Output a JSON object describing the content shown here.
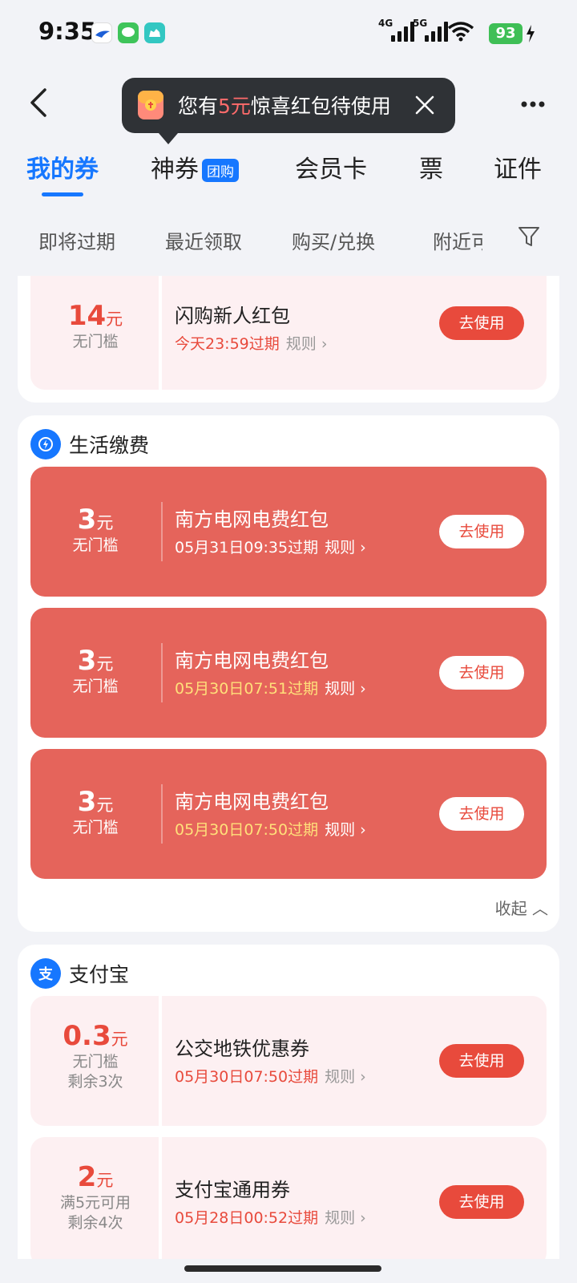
{
  "status": {
    "time": "9:35",
    "net1": "4G",
    "net2": "5G",
    "battery": "93"
  },
  "tooltip": {
    "prefix": "您有",
    "highlight": "5元",
    "suffix": "惊喜红包待使用"
  },
  "tabs": [
    {
      "label": "我的券"
    },
    {
      "label": "神券",
      "tag": "团购"
    },
    {
      "label": "会员卡"
    },
    {
      "label": "票"
    },
    {
      "label": "证件"
    }
  ],
  "filters": [
    "即将过期",
    "最近领取",
    "购买/兑换",
    "附近可"
  ],
  "colors": {
    "primary": "#1677ff",
    "coupon_red": "#e5645b",
    "accent_red": "#e84a3c",
    "gold": "#ffe07a"
  },
  "sections": {
    "top": {
      "coupon": {
        "amount": "14",
        "unit": "元",
        "cond1": "无门槛",
        "title": "闪购新人红包",
        "expiry": "今天23:59过期",
        "rule": "规则",
        "button": "去使用"
      }
    },
    "life": {
      "title": "生活缴费",
      "icon": "lightning-icon",
      "coupons": [
        {
          "amount": "3",
          "unit": "元",
          "cond1": "无门槛",
          "title": "南方电网电费红包",
          "expiry": "05月31日09:35过期",
          "rule": "规则",
          "button": "去使用"
        },
        {
          "amount": "3",
          "unit": "元",
          "cond1": "无门槛",
          "title": "南方电网电费红包",
          "expiry": "05月30日07:51过期",
          "rule": "规则",
          "button": "去使用"
        },
        {
          "amount": "3",
          "unit": "元",
          "cond1": "无门槛",
          "title": "南方电网电费红包",
          "expiry": "05月30日07:50过期",
          "rule": "规则",
          "button": "去使用"
        }
      ],
      "collapse": "收起"
    },
    "alipay": {
      "title": "支付宝",
      "icon": "alipay-icon",
      "coupons": [
        {
          "amount": "0.3",
          "unit": "元",
          "cond1": "无门槛",
          "cond2": "剩余3次",
          "title": "公交地铁优惠券",
          "expiry": "05月30日07:50过期",
          "rule": "规则",
          "button": "去使用"
        },
        {
          "amount": "2",
          "unit": "元",
          "cond1": "满5元可用",
          "cond2": "剩余4次",
          "title": "支付宝通用券",
          "expiry": "05月28日00:52过期",
          "rule": "规则",
          "button": "去使用"
        }
      ]
    }
  }
}
